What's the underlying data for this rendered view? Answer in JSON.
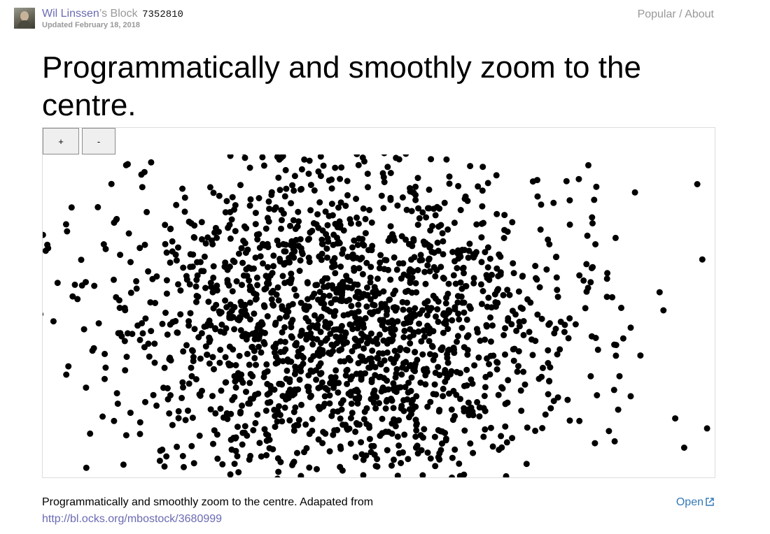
{
  "header": {
    "author": "Wil Linssen",
    "possessive": "’s",
    "block_word": "Block",
    "block_id": "7352810",
    "updated": "Updated February 18, 2018",
    "popular": "Popular",
    "separator": "/",
    "about": "About"
  },
  "page": {
    "title": "Programmatically and smoothly zoom to the centre."
  },
  "controls": {
    "zoom_in_label": "+",
    "zoom_out_label": "-"
  },
  "visualization": {
    "point_color": "#000000",
    "point_count": 2000
  },
  "description": {
    "text": "Programmatically and smoothly zoom to the centre. Adapated from",
    "link_text": "http://bl.ocks.org/mbostock/3680999"
  },
  "footer": {
    "open_label": "Open"
  }
}
